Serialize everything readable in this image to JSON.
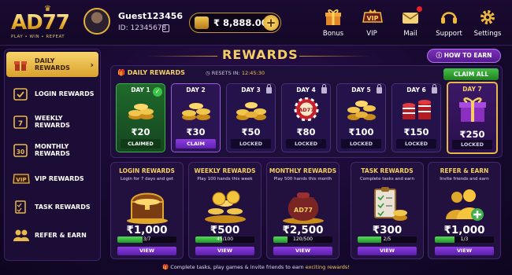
{
  "logo": {
    "text": "AD77",
    "tagline": "PLAY • WIN • REPEAT"
  },
  "user": {
    "name": "Guest123456",
    "id": "ID: 12345678"
  },
  "balance": {
    "value": "₹ 8,888.00",
    "add": "+"
  },
  "nav": [
    {
      "label": "Bonus",
      "icon": "gift-icon"
    },
    {
      "label": "VIP",
      "icon": "vip-icon"
    },
    {
      "label": "Mail",
      "icon": "mail-icon",
      "badge": true
    },
    {
      "label": "Support",
      "icon": "headset-icon"
    },
    {
      "label": "Settings",
      "icon": "gear-icon"
    }
  ],
  "sidebar": {
    "items": [
      {
        "label": "DAILY REWARDS",
        "icon": "gift-icon",
        "active": true
      },
      {
        "label": "LOGIN REWARDS",
        "icon": "calendar-check-icon"
      },
      {
        "label": "WEEKLY REWARDS",
        "icon": "calendar-7-icon"
      },
      {
        "label": "MONTHLY REWARDS",
        "icon": "calendar-30-icon"
      },
      {
        "label": "VIP REWARDS",
        "icon": "vip-icon"
      },
      {
        "label": "TASK REWARDS",
        "icon": "checklist-icon"
      },
      {
        "label": "REFER & EARN",
        "icon": "users-icon"
      }
    ]
  },
  "header": {
    "title": "REWARDS",
    "how_to_earn": "HOW TO EARN"
  },
  "daily": {
    "label": "DAILY REWARDS",
    "resets_label": "RESETS IN:",
    "resets_time": "12:45:30",
    "claim_all": "CLAIM ALL",
    "days": [
      {
        "day": "DAY 1",
        "amount": "₹20",
        "state": "CLAIMED"
      },
      {
        "day": "DAY 2",
        "amount": "₹30",
        "state": "CLAIM"
      },
      {
        "day": "DAY 3",
        "amount": "₹50",
        "state": "LOCKED"
      },
      {
        "day": "DAY 4",
        "amount": "₹80",
        "state": "LOCKED"
      },
      {
        "day": "DAY 5",
        "amount": "₹100",
        "state": "LOCKED"
      },
      {
        "day": "DAY 6",
        "amount": "₹150",
        "state": "LOCKED"
      },
      {
        "day": "DAY 7",
        "amount": "₹250",
        "state": "LOCKED"
      }
    ]
  },
  "cards": [
    {
      "title": "LOGIN REWARDS",
      "desc": "Login for 7 days and get",
      "amount": "₹1,000",
      "progress": "3/7",
      "fill": 0.43,
      "view": "VIEW"
    },
    {
      "title": "WEEKLY REWARDS",
      "desc": "Play 100 hands this week",
      "amount": "₹500",
      "progress": "45/100",
      "fill": 0.45,
      "view": "VIEW"
    },
    {
      "title": "MONTHLY REWARDS",
      "desc": "Play 500 hands this month",
      "amount": "₹2,500",
      "progress": "120/500",
      "fill": 0.24,
      "view": "VIEW"
    },
    {
      "title": "TASK REWARDS",
      "desc": "Complete tasks and earn",
      "amount": "₹300",
      "progress": "2/5",
      "fill": 0.4,
      "view": "VIEW"
    },
    {
      "title": "REFER & EARN",
      "desc": "Invite friends and earn",
      "amount": "₹1,000",
      "progress": "1/3",
      "fill": 0.33,
      "view": "VIEW"
    }
  ],
  "footer": {
    "text": "Complete tasks, play games & invite friends to earn ",
    "highlight": "exciting rewards!"
  },
  "colors": {
    "gold": "#f4cf63",
    "purple": "#8c3ce0",
    "green": "#3fb04b",
    "bg": "#170930"
  }
}
